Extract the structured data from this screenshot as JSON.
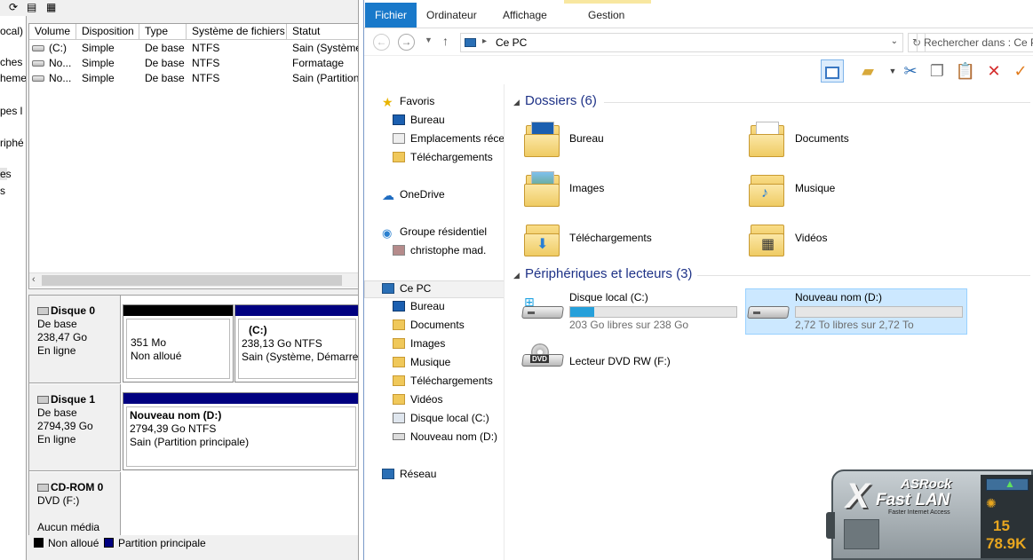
{
  "disk_mgmt": {
    "tree_items": [
      "ocal)",
      "ches",
      "heme",
      "pes l",
      "riphé",
      "es",
      "s"
    ],
    "columns": [
      "Volume",
      "Disposition",
      "Type",
      "Système de fichiers",
      "Statut"
    ],
    "volumes": [
      {
        "volume": "(C:)",
        "disposition": "Simple",
        "type": "De base",
        "fs": "NTFS",
        "status": "Sain (Système"
      },
      {
        "volume": "No...",
        "disposition": "Simple",
        "type": "De base",
        "fs": "NTFS",
        "status": "Formatage"
      },
      {
        "volume": "No...",
        "disposition": "Simple",
        "type": "De base",
        "fs": "NTFS",
        "status": "Sain (Partition"
      }
    ],
    "disks": [
      {
        "name": "Disque 0",
        "kind": "De base",
        "size": "238,47 Go",
        "state": "En ligne",
        "partitions": [
          {
            "line1": "351 Mo",
            "line2": "Non alloué"
          },
          {
            "line1": "(C:)",
            "line2": "238,13 Go NTFS",
            "line3": "Sain (Système, Démarrer,"
          }
        ]
      },
      {
        "name": "Disque 1",
        "kind": "De base",
        "size": "2794,39 Go",
        "state": "En ligne",
        "partitions": [
          {
            "line1": "Nouveau nom  (D:)",
            "line2": "2794,39 Go NTFS",
            "line3": "Sain (Partition principale)"
          }
        ]
      },
      {
        "name": "CD-ROM 0",
        "kind": "DVD (F:)",
        "media": "Aucun média"
      }
    ],
    "legend": [
      {
        "label": "Non alloué",
        "color": "#000000"
      },
      {
        "label": "Partition principale",
        "color": "#000080"
      }
    ]
  },
  "explorer": {
    "tabs": {
      "file": "Fichier",
      "computer": "Ordinateur",
      "view": "Affichage",
      "manage": "Gestion"
    },
    "address": "Ce PC",
    "search_placeholder": "Rechercher dans : Ce PC",
    "nav": {
      "favorites": "Favoris",
      "desktop": "Bureau",
      "recent": "Emplacements récen",
      "downloads": "Téléchargements",
      "onedrive": "OneDrive",
      "homegroup": "Groupe résidentiel",
      "user": "christophe mad.",
      "thispc": "Ce PC",
      "pc_desktop": "Bureau",
      "pc_documents": "Documents",
      "pc_images": "Images",
      "pc_music": "Musique",
      "pc_downloads": "Téléchargements",
      "pc_videos": "Vidéos",
      "pc_c": "Disque local (C:)",
      "pc_d": "Nouveau nom (D:)",
      "network": "Réseau"
    },
    "folders_header": "Dossiers (6)",
    "folders": [
      "Bureau",
      "Documents",
      "Images",
      "Musique",
      "Téléchargements",
      "Vidéos"
    ],
    "devices_header": "Périphériques et lecteurs (3)",
    "devices": [
      {
        "name": "Disque local (C:)",
        "free": "203 Go libres sur 238 Go",
        "used_fraction": 0.147
      },
      {
        "name": "Nouveau nom (D:)",
        "free": "2,72 To libres sur 2,72 To",
        "used_fraction": 0.0
      },
      {
        "name": "Lecteur DVD RW (F:)",
        "icon_text": "DVD"
      }
    ]
  },
  "xfast": {
    "brand": "ASRock",
    "title": "Fast LAN",
    "subtitle": "Faster Internet Access",
    "val1": "15",
    "val2": "78.9K"
  }
}
